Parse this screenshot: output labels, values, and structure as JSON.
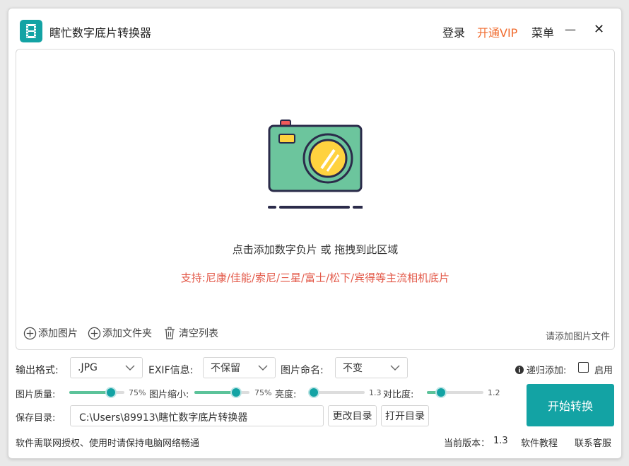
{
  "app": {
    "title": "瞎忙数字底片转换器"
  },
  "titlebar": {
    "login": "登录",
    "vip": "开通VIP",
    "menu": "菜单",
    "minimize": "—",
    "close": "✕"
  },
  "dropzone": {
    "hint": "点击添加数字负片 或 拖拽到此区域",
    "support": "支持:尼康/佳能/索尼/三星/富士/松下/宾得等主流相机底片",
    "add_image": "添加图片",
    "add_folder": "添加文件夹",
    "clear_list": "清空列表",
    "status": "请添加图片文件"
  },
  "options": {
    "format_label": "输出格式:",
    "format_value": ".JPG",
    "exif_label": "EXIF信息:",
    "exif_value": "不保留",
    "naming_label": "图片命名:",
    "naming_value": "不变",
    "recursive_label": "递归添加:",
    "recursive_toggle_label": "启用"
  },
  "sliders": {
    "quality_label": "图片质量:",
    "quality_value": "75%",
    "quality_level": 0.75,
    "scale_label": "图片缩小:",
    "scale_value": "75%",
    "scale_level": 0.75,
    "brightness_label": "亮度:",
    "brightness_value": "1.3",
    "brightness_level": 0.1,
    "contrast_label": "对比度:",
    "contrast_value": "1.2",
    "contrast_level": 0.25
  },
  "save": {
    "label": "保存目录:",
    "path": "C:\\Users\\89913\\瞎忙数字底片转换器",
    "change": "更改目录",
    "open": "打开目录"
  },
  "actions": {
    "start": "开始转换"
  },
  "footer": {
    "notice": "软件需联网授权、使用时请保持电脑网络畅通",
    "version_label": "当前版本：",
    "version": "1.3",
    "tutorial": "软件教程",
    "support": "联系客服"
  },
  "colors": {
    "accent": "#13a3a4",
    "vip": "#f06a2c",
    "support_text": "#e35a4a"
  }
}
